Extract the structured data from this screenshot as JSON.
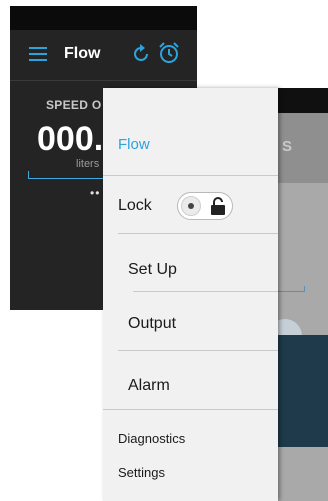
{
  "back_screen": {
    "title": "Flow",
    "speed_label": "SPEED O",
    "speed_value": "000.",
    "unit": "liters",
    "pager": "••"
  },
  "middle_screen": {
    "tab_fragment": "S"
  },
  "drawer": {
    "header_title": "Flow",
    "lock_label": "Lock",
    "lock_state": "unlocked",
    "items": [
      {
        "label": "Set Up"
      },
      {
        "label": "Output"
      },
      {
        "label": "Alarm"
      }
    ],
    "sub_items": [
      {
        "label": "Diagnostics"
      },
      {
        "label": "Settings"
      }
    ]
  },
  "colors": {
    "accent": "#2ba3dd",
    "back_background": "#242424",
    "drawer_background": "#f1f1f1"
  }
}
